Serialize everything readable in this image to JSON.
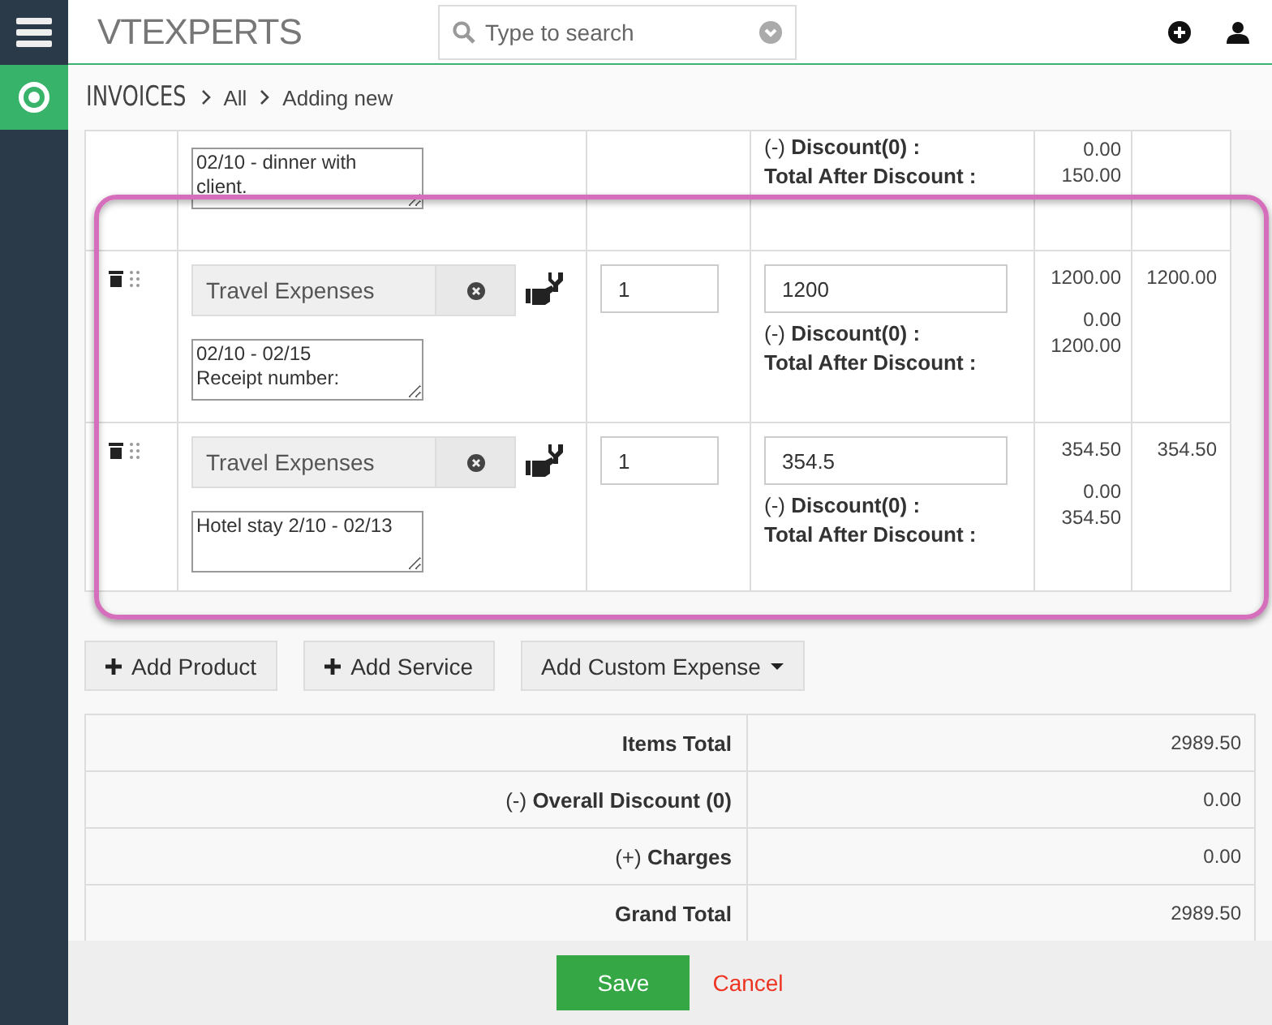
{
  "header": {
    "logo": "VTEXPERTS",
    "search": {
      "placeholder": "Type to search"
    }
  },
  "breadcrumb": {
    "module": "INVOICES",
    "items": [
      "All",
      "Adding new"
    ]
  },
  "partial_row": {
    "description": "02/10 - dinner with\nclient.",
    "discount_label": "(-) **Discount(0) :**",
    "after_label": "Total After Discount :",
    "discount": "0.00",
    "after": "150.00"
  },
  "items": [
    {
      "product": "Travel Expenses",
      "description": "02/10 - 02/15\nReceipt number:",
      "quantity": "1",
      "price": "1200",
      "discount_label": "(-) **Discount(0) :**",
      "after_label": "Total After Discount :",
      "total": "1200.00",
      "discount": "0.00",
      "after": "1200.00",
      "net": "1200.00"
    },
    {
      "product": "Travel Expenses",
      "description": "Hotel stay 2/10 - 02/13",
      "quantity": "1",
      "price": "354.5",
      "discount_label": "(-) **Discount(0) :**",
      "after_label": "Total After Discount :",
      "total": "354.50",
      "discount": "0.00",
      "after": "354.50",
      "net": "354.50"
    }
  ],
  "actions": [
    {
      "label": "Add Product",
      "kind": "plus"
    },
    {
      "label": "Add Service",
      "kind": "plus"
    },
    {
      "label": "Add Custom Expense",
      "kind": "dropdown"
    }
  ],
  "summary": [
    {
      "label": "Items Total",
      "value": "2989.50"
    },
    {
      "label": "(-) **Overall Discount (0)**",
      "value": "0.00"
    },
    {
      "label": "(+) **Charges**",
      "value": "0.00"
    },
    {
      "label": "Grand Total",
      "value": "2989.50"
    }
  ],
  "footer": {
    "save": "Save",
    "cancel": "Cancel"
  }
}
